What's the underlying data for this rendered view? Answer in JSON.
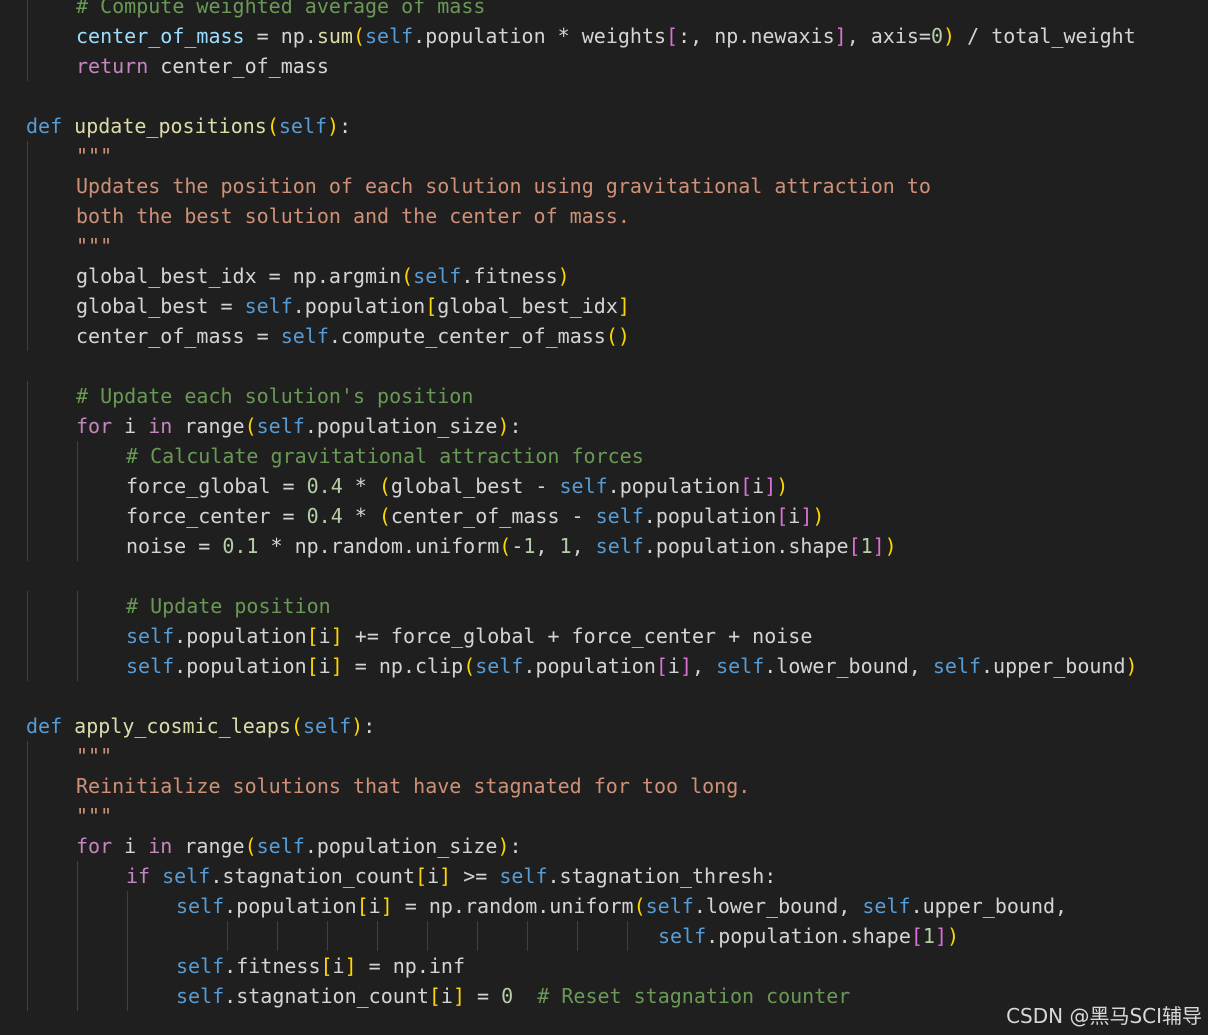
{
  "editor": {
    "lines": [
      {
        "indent": 1,
        "tokens": [
          {
            "t": "# Compute weighted average of mass",
            "c": "cmt"
          }
        ]
      },
      {
        "indent": 1,
        "tokens": [
          {
            "t": "center_of_mass",
            "c": "var"
          },
          {
            "t": " = np.",
            "c": "plain"
          },
          {
            "t": "sum",
            "c": "fn"
          },
          {
            "t": "(",
            "c": "br1"
          },
          {
            "t": "self",
            "c": "self"
          },
          {
            "t": ".population * weights",
            "c": "plain"
          },
          {
            "t": "[",
            "c": "br2"
          },
          {
            "t": ":, np.newaxis",
            "c": "plain"
          },
          {
            "t": "]",
            "c": "br2"
          },
          {
            "t": ", axis=",
            "c": "plain"
          },
          {
            "t": "0",
            "c": "num"
          },
          {
            "t": ")",
            "c": "br1"
          },
          {
            "t": " / total_weight",
            "c": "plain"
          }
        ]
      },
      {
        "indent": 1,
        "tokens": [
          {
            "t": "return",
            "c": "ctl"
          },
          {
            "t": " center_of_mass",
            "c": "plain"
          }
        ]
      },
      {
        "indent": 0,
        "tokens": []
      },
      {
        "indent": 0,
        "tokens": [
          {
            "t": "def",
            "c": "kw"
          },
          {
            "t": " ",
            "c": "plain"
          },
          {
            "t": "update_positions",
            "c": "fn"
          },
          {
            "t": "(",
            "c": "br1"
          },
          {
            "t": "self",
            "c": "self"
          },
          {
            "t": ")",
            "c": "br1"
          },
          {
            "t": ":",
            "c": "plain"
          }
        ]
      },
      {
        "indent": 1,
        "tokens": [
          {
            "t": "\"\"\"",
            "c": "str"
          }
        ]
      },
      {
        "indent": 1,
        "tokens": [
          {
            "t": "Updates the position of each solution using gravitational attraction to",
            "c": "str"
          }
        ]
      },
      {
        "indent": 1,
        "tokens": [
          {
            "t": "both the best solution and the center of mass.",
            "c": "str"
          }
        ]
      },
      {
        "indent": 1,
        "tokens": [
          {
            "t": "\"\"\"",
            "c": "str"
          }
        ]
      },
      {
        "indent": 1,
        "tokens": [
          {
            "t": "global_best_idx = np.argmin",
            "c": "plain"
          },
          {
            "t": "(",
            "c": "br1"
          },
          {
            "t": "self",
            "c": "self"
          },
          {
            "t": ".fitness",
            "c": "plain"
          },
          {
            "t": ")",
            "c": "br1"
          }
        ]
      },
      {
        "indent": 1,
        "tokens": [
          {
            "t": "global_best = ",
            "c": "plain"
          },
          {
            "t": "self",
            "c": "self"
          },
          {
            "t": ".population",
            "c": "plain"
          },
          {
            "t": "[",
            "c": "br1"
          },
          {
            "t": "global_best_idx",
            "c": "plain"
          },
          {
            "t": "]",
            "c": "br1"
          }
        ]
      },
      {
        "indent": 1,
        "tokens": [
          {
            "t": "center_of_mass = ",
            "c": "plain"
          },
          {
            "t": "self",
            "c": "self"
          },
          {
            "t": ".compute_center_of_mass",
            "c": "plain"
          },
          {
            "t": "()",
            "c": "br1"
          }
        ]
      },
      {
        "indent": 0,
        "tokens": []
      },
      {
        "indent": 1,
        "tokens": [
          {
            "t": "# Update each solution's position",
            "c": "cmt"
          }
        ]
      },
      {
        "indent": 1,
        "tokens": [
          {
            "t": "for",
            "c": "ctl"
          },
          {
            "t": " i ",
            "c": "plain"
          },
          {
            "t": "in",
            "c": "ctl"
          },
          {
            "t": " range",
            "c": "plain"
          },
          {
            "t": "(",
            "c": "br1"
          },
          {
            "t": "self",
            "c": "self"
          },
          {
            "t": ".population_size",
            "c": "plain"
          },
          {
            "t": ")",
            "c": "br1"
          },
          {
            "t": ":",
            "c": "plain"
          }
        ]
      },
      {
        "indent": 2,
        "tokens": [
          {
            "t": "# Calculate gravitational attraction forces",
            "c": "cmt"
          }
        ]
      },
      {
        "indent": 2,
        "tokens": [
          {
            "t": "force_global = ",
            "c": "plain"
          },
          {
            "t": "0.4",
            "c": "num"
          },
          {
            "t": " * ",
            "c": "plain"
          },
          {
            "t": "(",
            "c": "br1"
          },
          {
            "t": "global_best - ",
            "c": "plain"
          },
          {
            "t": "self",
            "c": "self"
          },
          {
            "t": ".population",
            "c": "plain"
          },
          {
            "t": "[",
            "c": "br2"
          },
          {
            "t": "i",
            "c": "plain"
          },
          {
            "t": "]",
            "c": "br2"
          },
          {
            "t": ")",
            "c": "br1"
          }
        ]
      },
      {
        "indent": 2,
        "tokens": [
          {
            "t": "force_center = ",
            "c": "plain"
          },
          {
            "t": "0.4",
            "c": "num"
          },
          {
            "t": " * ",
            "c": "plain"
          },
          {
            "t": "(",
            "c": "br1"
          },
          {
            "t": "center_of_mass - ",
            "c": "plain"
          },
          {
            "t": "self",
            "c": "self"
          },
          {
            "t": ".population",
            "c": "plain"
          },
          {
            "t": "[",
            "c": "br2"
          },
          {
            "t": "i",
            "c": "plain"
          },
          {
            "t": "]",
            "c": "br2"
          },
          {
            "t": ")",
            "c": "br1"
          }
        ]
      },
      {
        "indent": 2,
        "tokens": [
          {
            "t": "noise = ",
            "c": "plain"
          },
          {
            "t": "0.1",
            "c": "num"
          },
          {
            "t": " * np.random.uniform",
            "c": "plain"
          },
          {
            "t": "(",
            "c": "br1"
          },
          {
            "t": "-",
            "c": "plain"
          },
          {
            "t": "1",
            "c": "num"
          },
          {
            "t": ", ",
            "c": "plain"
          },
          {
            "t": "1",
            "c": "num"
          },
          {
            "t": ", ",
            "c": "plain"
          },
          {
            "t": "self",
            "c": "self"
          },
          {
            "t": ".population.shape",
            "c": "plain"
          },
          {
            "t": "[",
            "c": "br2"
          },
          {
            "t": "1",
            "c": "num"
          },
          {
            "t": "]",
            "c": "br2"
          },
          {
            "t": ")",
            "c": "br1"
          }
        ]
      },
      {
        "indent": 0,
        "tokens": []
      },
      {
        "indent": 2,
        "tokens": [
          {
            "t": "# Update position",
            "c": "cmt"
          }
        ]
      },
      {
        "indent": 2,
        "tokens": [
          {
            "t": "self",
            "c": "self"
          },
          {
            "t": ".population",
            "c": "plain"
          },
          {
            "t": "[",
            "c": "br1"
          },
          {
            "t": "i",
            "c": "plain"
          },
          {
            "t": "]",
            "c": "br1"
          },
          {
            "t": " += force_global + force_center + noise",
            "c": "plain"
          }
        ]
      },
      {
        "indent": 2,
        "tokens": [
          {
            "t": "self",
            "c": "self"
          },
          {
            "t": ".population",
            "c": "plain"
          },
          {
            "t": "[",
            "c": "br1"
          },
          {
            "t": "i",
            "c": "plain"
          },
          {
            "t": "]",
            "c": "br1"
          },
          {
            "t": " = np.clip",
            "c": "plain"
          },
          {
            "t": "(",
            "c": "br1"
          },
          {
            "t": "self",
            "c": "self"
          },
          {
            "t": ".population",
            "c": "plain"
          },
          {
            "t": "[",
            "c": "br2"
          },
          {
            "t": "i",
            "c": "plain"
          },
          {
            "t": "]",
            "c": "br2"
          },
          {
            "t": ", ",
            "c": "plain"
          },
          {
            "t": "self",
            "c": "self"
          },
          {
            "t": ".lower_bound, ",
            "c": "plain"
          },
          {
            "t": "self",
            "c": "self"
          },
          {
            "t": ".upper_bound",
            "c": "plain"
          },
          {
            "t": ")",
            "c": "br1"
          }
        ]
      },
      {
        "indent": 0,
        "tokens": []
      },
      {
        "indent": 0,
        "tokens": [
          {
            "t": "def",
            "c": "kw"
          },
          {
            "t": " ",
            "c": "plain"
          },
          {
            "t": "apply_cosmic_leaps",
            "c": "fn"
          },
          {
            "t": "(",
            "c": "br1"
          },
          {
            "t": "self",
            "c": "self"
          },
          {
            "t": ")",
            "c": "br1"
          },
          {
            "t": ":",
            "c": "plain"
          }
        ]
      },
      {
        "indent": 1,
        "tokens": [
          {
            "t": "\"\"\"",
            "c": "str"
          }
        ]
      },
      {
        "indent": 1,
        "tokens": [
          {
            "t": "Reinitialize solutions that have stagnated for too long.",
            "c": "str"
          }
        ]
      },
      {
        "indent": 1,
        "tokens": [
          {
            "t": "\"\"\"",
            "c": "str"
          }
        ]
      },
      {
        "indent": 1,
        "tokens": [
          {
            "t": "for",
            "c": "ctl"
          },
          {
            "t": " i ",
            "c": "plain"
          },
          {
            "t": "in",
            "c": "ctl"
          },
          {
            "t": " range",
            "c": "plain"
          },
          {
            "t": "(",
            "c": "br1"
          },
          {
            "t": "self",
            "c": "self"
          },
          {
            "t": ".population_size",
            "c": "plain"
          },
          {
            "t": ")",
            "c": "br1"
          },
          {
            "t": ":",
            "c": "plain"
          }
        ]
      },
      {
        "indent": 2,
        "tokens": [
          {
            "t": "if",
            "c": "ctl"
          },
          {
            "t": " ",
            "c": "plain"
          },
          {
            "t": "self",
            "c": "self"
          },
          {
            "t": ".stagnation_count",
            "c": "plain"
          },
          {
            "t": "[",
            "c": "br1"
          },
          {
            "t": "i",
            "c": "plain"
          },
          {
            "t": "]",
            "c": "br1"
          },
          {
            "t": " >= ",
            "c": "plain"
          },
          {
            "t": "self",
            "c": "self"
          },
          {
            "t": ".stagnation_thresh:",
            "c": "plain"
          }
        ]
      },
      {
        "indent": 3,
        "tokens": [
          {
            "t": "self",
            "c": "self"
          },
          {
            "t": ".population",
            "c": "plain"
          },
          {
            "t": "[",
            "c": "br1"
          },
          {
            "t": "i",
            "c": "plain"
          },
          {
            "t": "]",
            "c": "br1"
          },
          {
            "t": " = np.random.uniform",
            "c": "plain"
          },
          {
            "t": "(",
            "c": "br1"
          },
          {
            "t": "self",
            "c": "self"
          },
          {
            "t": ".lower_bound, ",
            "c": "plain"
          },
          {
            "t": "self",
            "c": "self"
          },
          {
            "t": ".upper_bound,",
            "c": "plain"
          }
        ]
      },
      {
        "indent": 3,
        "cont": true,
        "tokens": [
          {
            "t": "self",
            "c": "self"
          },
          {
            "t": ".population.shape",
            "c": "plain"
          },
          {
            "t": "[",
            "c": "br2"
          },
          {
            "t": "1",
            "c": "num"
          },
          {
            "t": "]",
            "c": "br2"
          },
          {
            "t": ")",
            "c": "br1"
          }
        ]
      },
      {
        "indent": 3,
        "tokens": [
          {
            "t": "self",
            "c": "self"
          },
          {
            "t": ".fitness",
            "c": "plain"
          },
          {
            "t": "[",
            "c": "br1"
          },
          {
            "t": "i",
            "c": "plain"
          },
          {
            "t": "]",
            "c": "br1"
          },
          {
            "t": " = np.inf",
            "c": "plain"
          }
        ]
      },
      {
        "indent": 3,
        "tokens": [
          {
            "t": "self",
            "c": "self"
          },
          {
            "t": ".stagnation_count",
            "c": "plain"
          },
          {
            "t": "[",
            "c": "br1"
          },
          {
            "t": "i",
            "c": "plain"
          },
          {
            "t": "]",
            "c": "br1"
          },
          {
            "t": " = ",
            "c": "plain"
          },
          {
            "t": "0",
            "c": "num"
          },
          {
            "t": "  ",
            "c": "plain"
          },
          {
            "t": "# Reset stagnation counter",
            "c": "cmt"
          }
        ]
      }
    ]
  },
  "watermark": "CSDN @黑马SCI辅导"
}
